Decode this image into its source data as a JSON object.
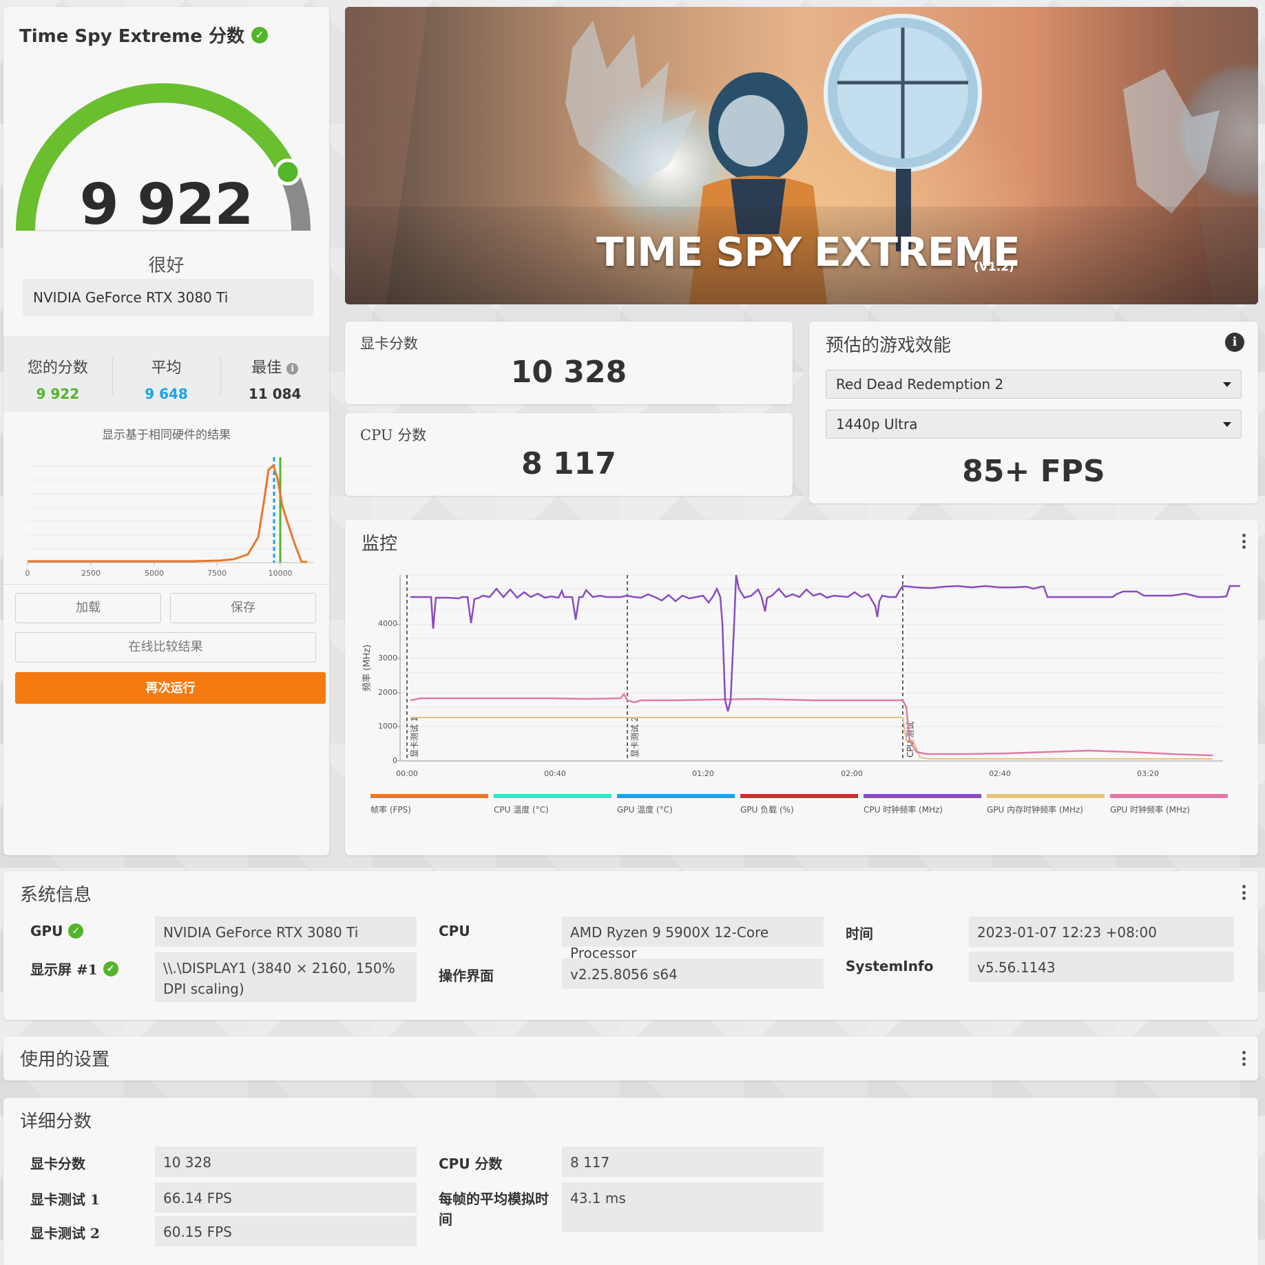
{
  "left": {
    "title": "Time Spy Extreme 分数",
    "score": "9 922",
    "rating": "很好",
    "gpu": "NVIDIA GeForce RTX 3080 Ti",
    "stats": {
      "yours_label": "您的分数",
      "yours_value": "9 922",
      "avg_label": "平均",
      "avg_value": "9 648",
      "best_label": "最佳",
      "best_value": "11 084"
    },
    "gauge_fraction": 0.86,
    "hist_caption": "显示基于相同硬件的结果",
    "hist_ticks": [
      "0",
      "2500",
      "5000",
      "7500",
      "10000"
    ],
    "buttons": {
      "load": "加载",
      "save": "保存",
      "compare": "在线比较结果",
      "run": "再次运行"
    }
  },
  "banner": {
    "title": "TIME SPY EXTREME",
    "version": "(V1.2)"
  },
  "gpu_score": {
    "label": "显卡分数",
    "value": "10 328"
  },
  "cpu_score": {
    "label": "CPU 分数",
    "value": "8 117"
  },
  "perf": {
    "title": "预估的游戏效能",
    "game": "Red Dead Redemption 2",
    "resolution": "1440p Ultra",
    "fps": "85+ FPS"
  },
  "monitor": {
    "title": "监控",
    "y_label": "频率 (MHz)",
    "y_ticks": [
      "0",
      "1000",
      "2000",
      "3000",
      "4000"
    ],
    "x_ticks": [
      "00:00",
      "00:40",
      "01:20",
      "02:00",
      "02:40",
      "03:20"
    ],
    "markers": [
      "显卡测试 1",
      "显卡测试 2",
      "CPU 测试"
    ],
    "legend": [
      {
        "label": "帧率 (FPS)",
        "color": "#e8772b"
      },
      {
        "label": "CPU 温度 (°C)",
        "color": "#33e8c3"
      },
      {
        "label": "GPU 温度 (°C)",
        "color": "#1aa3e8"
      },
      {
        "label": "GPU 负载 (%)",
        "color": "#c8302f"
      },
      {
        "label": "CPU 时钟频率 (MHz)",
        "color": "#8a4bbf"
      },
      {
        "label": "GPU 内存时钟频率 (MHz)",
        "color": "#e6c27a"
      },
      {
        "label": "GPU 时钟频率 (MHz)",
        "color": "#e07aa8"
      }
    ]
  },
  "sysinfo": {
    "title": "系统信息",
    "gpu_label": "GPU",
    "gpu_value": "NVIDIA GeForce RTX 3080 Ti",
    "display_label": "显示屏 #1",
    "display_value": "\\\\.\\DISPLAY1 (3840 × 2160, 150% DPI scaling)",
    "cpu_label": "CPU",
    "cpu_value": "AMD Ryzen 9 5900X 12-Core Processor",
    "ui_label": "操作界面",
    "ui_value": "v2.25.8056 s64",
    "time_label": "时间",
    "time_value": "2023-01-07 12:23 +08:00",
    "sysinfo_label": "SystemInfo",
    "sysinfo_value": "v5.56.1143"
  },
  "settings": {
    "title": "使用的设置"
  },
  "details": {
    "title": "详细分数",
    "gpu_score_label": "显卡分数",
    "gpu_score_value": "10 328",
    "gt1_label": "显卡测试 1",
    "gt1_value": "66.14 FPS",
    "gt2_label": "显卡测试 2",
    "gt2_value": "60.15 FPS",
    "cpu_score_label": "CPU 分数",
    "cpu_score_value": "8 117",
    "cpu_sim_label": "每帧的平均模拟时间",
    "cpu_sim_value": "43.1 ms"
  }
}
